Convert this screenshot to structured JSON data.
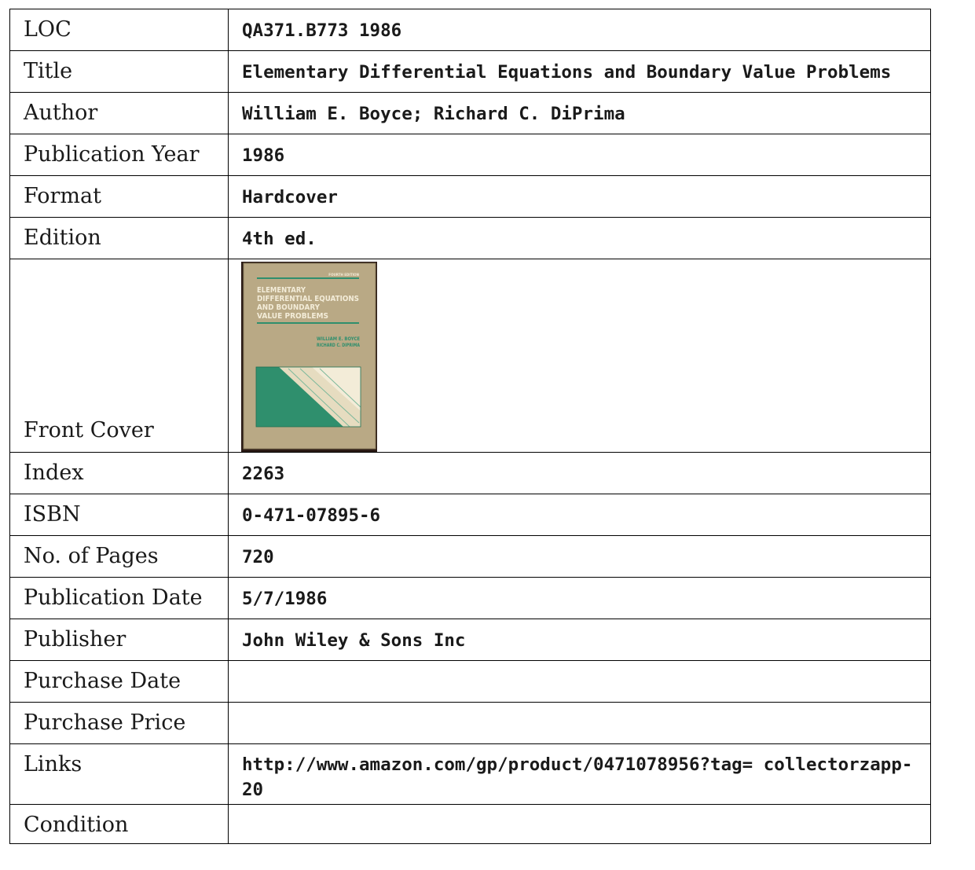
{
  "rows": {
    "loc": {
      "label": "LOC",
      "value": "QA371.B773 1986"
    },
    "title": {
      "label": "Title",
      "value": "Elementary Differential Equations and Boundary Value Problems"
    },
    "author": {
      "label": "Author",
      "value": "William E. Boyce; Richard C. DiPrima"
    },
    "pub_year": {
      "label": "Publication Year",
      "value": "1986"
    },
    "format": {
      "label": "Format",
      "value": "Hardcover"
    },
    "edition": {
      "label": "Edition",
      "value": "4th ed."
    },
    "front_cover": {
      "label": "Front Cover",
      "cover": {
        "edition_text": "FOURTH EDITION",
        "title_lines": [
          "ELEMENTARY",
          "DIFFERENTIAL EQUATIONS",
          "AND BOUNDARY",
          "VALUE PROBLEMS"
        ],
        "author_lines": [
          "WILLIAM E. BOYCE",
          "RICHARD C. DIPRIMA"
        ],
        "colors": {
          "board": "#b9a985",
          "green": "#2f8f6d",
          "cream": "#e6dcc0",
          "binding": "#2a1a14"
        }
      }
    },
    "index": {
      "label": "Index",
      "value": "2263"
    },
    "isbn": {
      "label": "ISBN",
      "value": "0-471-07895-6"
    },
    "pages": {
      "label": "No. of Pages",
      "value": "720"
    },
    "pub_date": {
      "label": "Publication Date",
      "value": "5/7/1986"
    },
    "publisher": {
      "label": "Publisher",
      "value": "John Wiley & Sons Inc"
    },
    "purchase_date": {
      "label": "Purchase Date",
      "value": ""
    },
    "purchase_price": {
      "label": "Purchase Price",
      "value": ""
    },
    "links": {
      "label": "Links",
      "value": "http://www.amazon.com/gp/product/0471078956?tag= collectorzapp-20"
    },
    "condition": {
      "label": "Condition",
      "value": ""
    }
  }
}
